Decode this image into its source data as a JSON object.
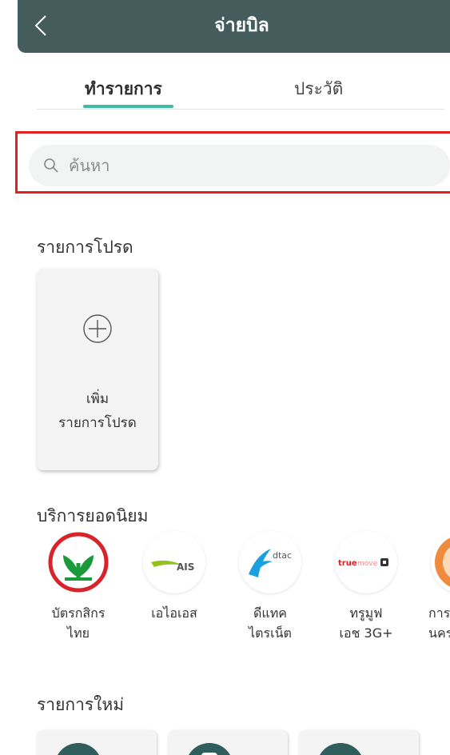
{
  "header": {
    "title": "จ่ายบิล"
  },
  "tabs": [
    {
      "label": "ทำรายการ",
      "active": true
    },
    {
      "label": "ประวัติ",
      "active": false
    }
  ],
  "search": {
    "placeholder": "ค้นหา"
  },
  "favorites": {
    "heading": "รายการโปรด",
    "add_card": {
      "line1": "เพิ่ม",
      "line2": "รายการโปรด"
    }
  },
  "popular": {
    "heading": "บริการยอดนิยม",
    "items": [
      {
        "line1": "บัตรกสิกร",
        "line2": "ไทย",
        "logo": "kbank-logo"
      },
      {
        "line1": "เอไอเอส",
        "line2": "",
        "logo": "ais-logo",
        "logo_text": "AIS"
      },
      {
        "line1": "ดีแทค",
        "line2": "ไตรเน็ต",
        "logo": "dtac-logo",
        "logo_text": "dtac"
      },
      {
        "line1": "ทรูมูฟ",
        "line2": "เอช 3G+",
        "logo": "truemove-logo",
        "logo_text": "true",
        "logo_text2": "move"
      },
      {
        "line1": "การ",
        "line2": "นคร",
        "logo": "mea-logo"
      }
    ]
  },
  "new_items": {
    "heading": "รายการใหม่"
  },
  "colors": {
    "header_bg": "#445c5c",
    "accent": "#3dbda7",
    "highlight_border": "#e4201f",
    "kbank_green": "#1b9a3c",
    "kbank_red": "#d8232a",
    "ais_green": "#95c11f",
    "dtac_blue": "#1aa0dc",
    "true_red": "#e11f26"
  }
}
